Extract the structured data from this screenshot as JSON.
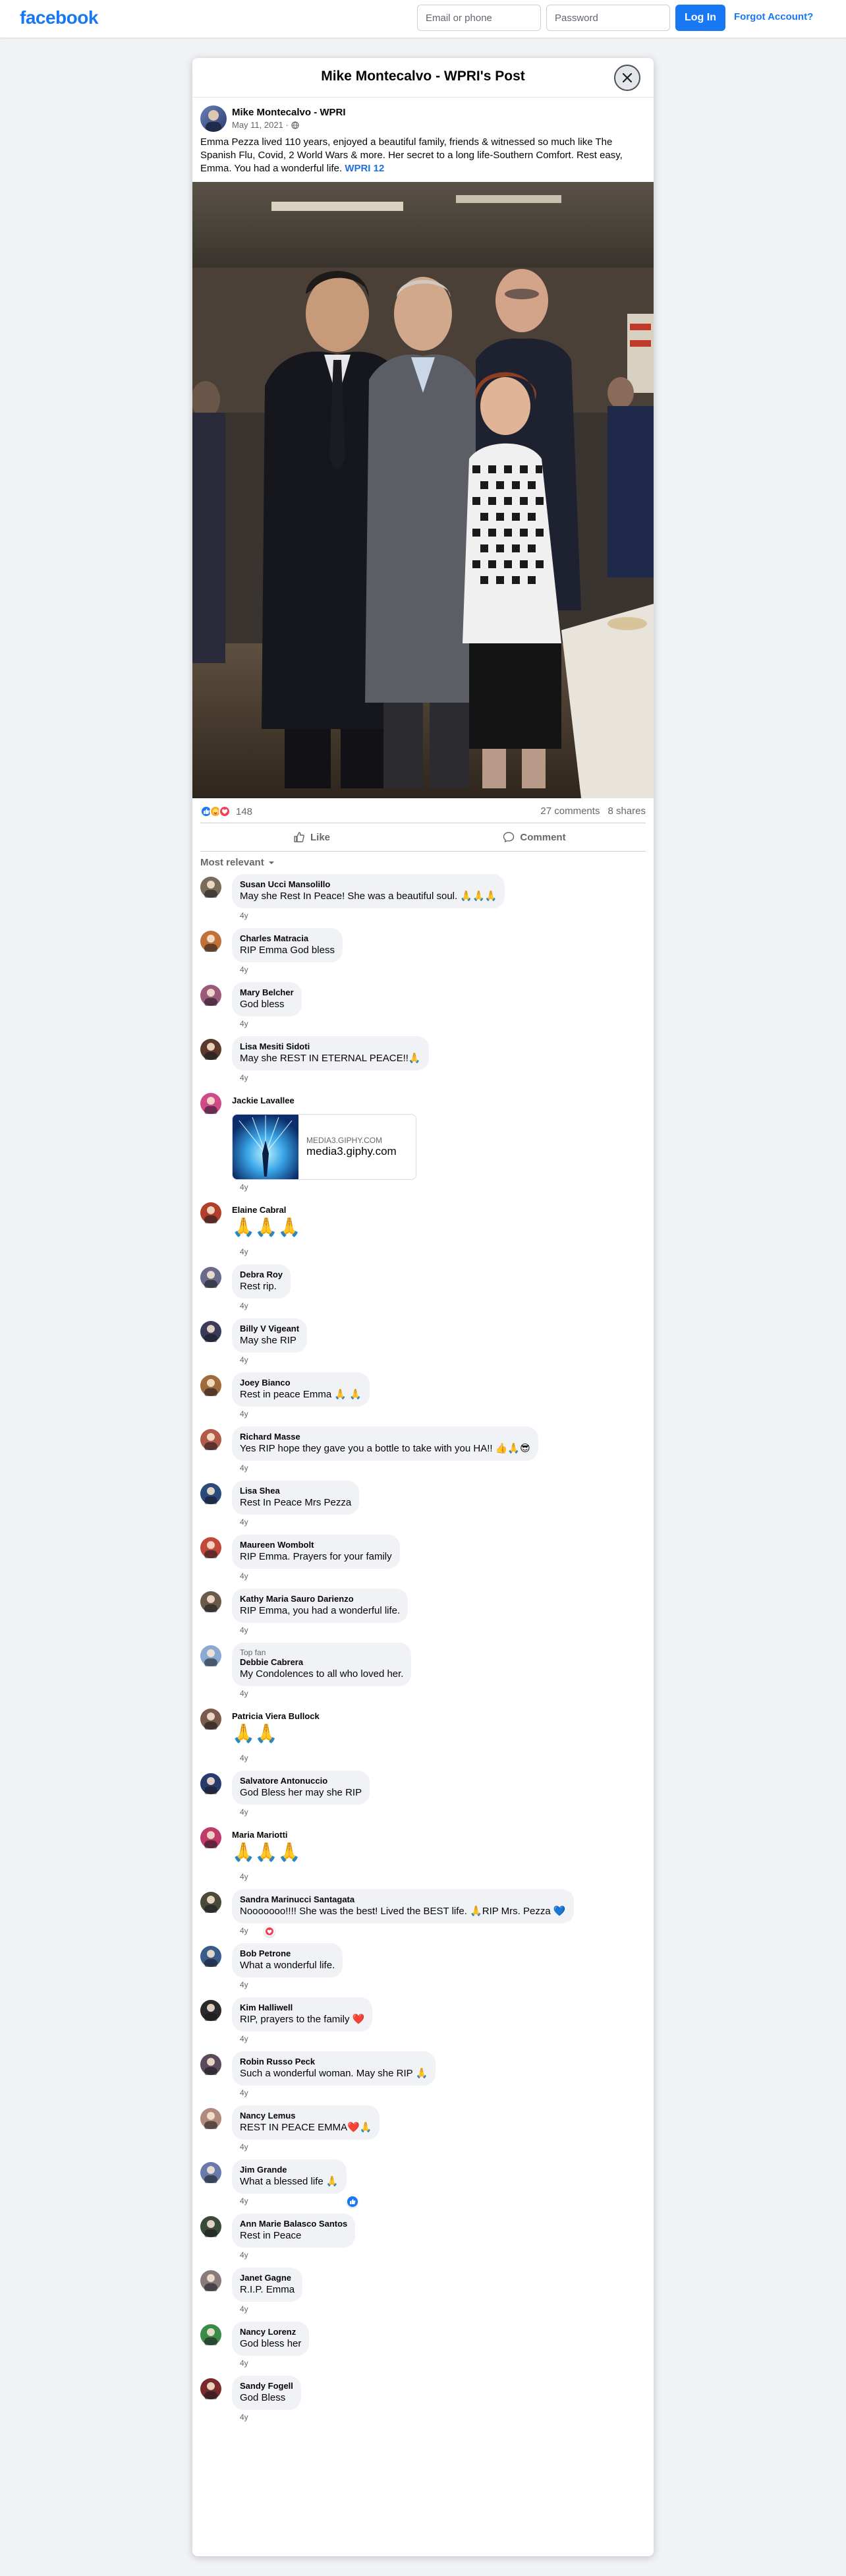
{
  "topbar": {
    "logo": "facebook",
    "email_placeholder": "Email or phone",
    "password_placeholder": "Password",
    "login_label": "Log In",
    "forgot_label": "Forgot Account?"
  },
  "modal": {
    "title": "Mike Montecalvo - WPRI's Post"
  },
  "post": {
    "author": "Mike Montecalvo - WPRI",
    "date": "May 11, 2021 ·",
    "text": "Emma Pezza lived 110 years, enjoyed a beautiful family, friends & witnessed so much like The Spanish Flu, Covid, 2 World Wars & more.  Her secret to a long life-Southern Comfort.  Rest easy, Emma.  You had a wonderful life.",
    "tag": "WPRI 12",
    "reaction_count": "148",
    "comments_count": "27 comments",
    "shares_count": "8 shares",
    "like_label": "Like",
    "comment_label": "Comment",
    "sort_label": "Most relevant"
  },
  "comments": [
    {
      "name": "Susan Ucci Mansolillo",
      "text": "May she Rest In Peace! She was a beautiful soul. 🙏🙏🙏",
      "time": "4y",
      "color": "#7a6a5a"
    },
    {
      "name": "Charles Matracia",
      "text": "RIP Emma God bless",
      "time": "4y",
      "color": "#c0703a"
    },
    {
      "name": "Mary Belcher",
      "text": "God bless",
      "time": "4y",
      "color": "#9c5a7a"
    },
    {
      "name": "Lisa Mesiti Sidoti",
      "text": "May she REST IN ETERNAL PEACE!!🙏",
      "time": "4y",
      "color": "#5a3a2a"
    },
    {
      "name": "Jackie Lavallee",
      "giphy_domain": "MEDIA3.GIPHY.COM",
      "giphy_title": "media3.giphy.com",
      "time": "4y",
      "color": "#d04a8a"
    },
    {
      "name": "Elaine Cabral",
      "text": "🙏🙏🙏",
      "big": true,
      "time": "4y",
      "color": "#b0402a"
    },
    {
      "name": "Debra Roy",
      "text": "Rest rip.",
      "time": "4y",
      "color": "#6a6a8a"
    },
    {
      "name": "Billy V Vigeant",
      "text": "May she RIP",
      "time": "4y",
      "color": "#3a3a5a"
    },
    {
      "name": "Joey Bianco",
      "text": "Rest in peace Emma 🙏 🙏",
      "time": "4y",
      "color": "#a06a3a"
    },
    {
      "name": "Richard Masse",
      "text": "Yes RIP hope they gave you a bottle to take with you HA!! 👍🙏😎",
      "time": "4y",
      "color": "#b05a4a"
    },
    {
      "name": "Lisa Shea",
      "text": "Rest In Peace Mrs Pezza",
      "time": "4y",
      "color": "#2a4a7a"
    },
    {
      "name": "Maureen Wombolt",
      "text": "RIP Emma. Prayers for your family",
      "time": "4y",
      "color": "#c04a3a"
    },
    {
      "name": "Kathy Maria Sauro Darienzo",
      "text": "RIP Emma, you had a wonderful life.",
      "time": "4y",
      "color": "#6a5a4a"
    },
    {
      "name": "Debbie Cabrera",
      "top_fan": "Top fan",
      "text": "My Condolences to all who loved her.",
      "time": "4y",
      "color": "#8aaad0"
    },
    {
      "name": "Patricia Viera Bullock",
      "text": "🙏🙏",
      "big": true,
      "time": "4y",
      "color": "#7a5a4a"
    },
    {
      "name": "Salvatore Antonuccio",
      "text": "God Bless her may she RIP",
      "time": "4y",
      "color": "#2a3a6a"
    },
    {
      "name": "Maria Mariotti",
      "text": "🙏🙏🙏",
      "big": true,
      "time": "4y",
      "color": "#c03a6a"
    },
    {
      "name": "Sandra Marinucci Santagata",
      "text": "Nooooooo!!!! She was the best! Lived the BEST life. 🙏RIP Mrs. Pezza 💙",
      "time": "4y",
      "reaction": "love",
      "color": "#4a4a3a"
    },
    {
      "name": "Bob Petrone",
      "text": "What a wonderful life.",
      "time": "4y",
      "color": "#3a5a8a"
    },
    {
      "name": "Kim Halliwell",
      "text": "RIP, prayers to the family ❤️",
      "time": "4y",
      "color": "#2a2a2a"
    },
    {
      "name": "Robin Russo Peck",
      "text": "Such a wonderful woman. May she RIP 🙏",
      "time": "4y",
      "color": "#5a4a5a"
    },
    {
      "name": "Nancy Lemus",
      "text": "REST IN PEACE EMMA❤️🙏",
      "time": "4y",
      "color": "#b08a7a"
    },
    {
      "name": "Jim Grande",
      "text": "What a blessed life 🙏",
      "time": "4y",
      "reaction": "like",
      "color": "#6a7aaa"
    },
    {
      "name": "Ann Marie Balasco Santos",
      "text": "Rest in Peace",
      "time": "4y",
      "color": "#3a4a3a"
    },
    {
      "name": "Janet Gagne",
      "text": "R.I.P. Emma",
      "time": "4y",
      "color": "#8a7a7a"
    },
    {
      "name": "Nancy Lorenz",
      "text": "God bless her",
      "time": "4y",
      "color": "#3a8a4a"
    },
    {
      "name": "Sandy Fogell",
      "text": "God Bless",
      "time": "4y",
      "color": "#7a2a2a"
    }
  ],
  "colors": {
    "brand": "#1877f2",
    "link": "#216fdb",
    "muted": "#65676b"
  }
}
